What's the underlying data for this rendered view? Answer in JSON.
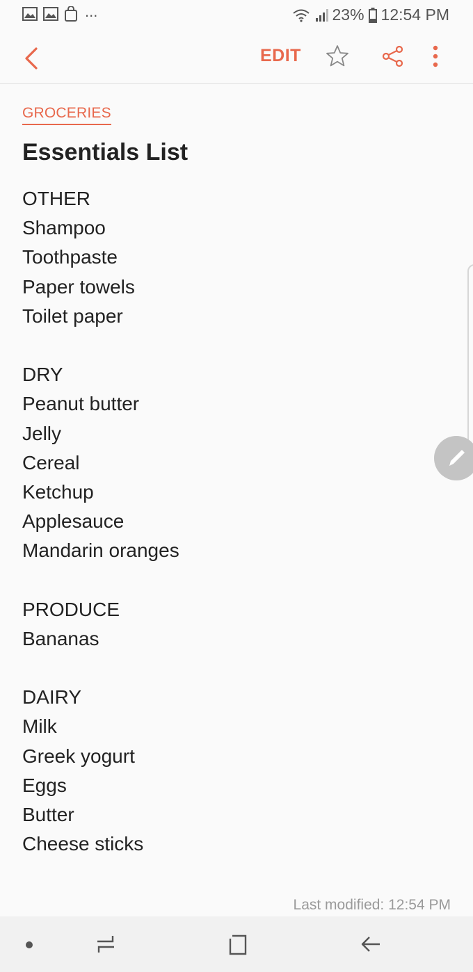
{
  "status_bar": {
    "battery": "23%",
    "time": "12:54 PM",
    "overflow": "..."
  },
  "toolbar": {
    "edit_label": "EDIT"
  },
  "note": {
    "category": "GROCERIES",
    "title": "Essentials List",
    "lines": [
      "OTHER",
      "Shampoo",
      "Toothpaste",
      "Paper towels",
      "Toilet paper",
      "",
      "DRY",
      "Peanut butter",
      "Jelly",
      "Cereal",
      "Ketchup",
      "Applesauce",
      "Mandarin oranges",
      "",
      "PRODUCE",
      "Bananas",
      "",
      "DAIRY",
      "Milk",
      "Greek yogurt",
      "Eggs",
      "Butter",
      "Cheese sticks"
    ],
    "last_modified": "Last modified: 12:54 PM"
  },
  "colors": {
    "accent": "#e8684c",
    "text": "#222222",
    "muted": "#9a9a9a",
    "background": "#fafafa"
  },
  "icons": {
    "status_left": [
      "image-icon",
      "image-icon",
      "shopping-bag-icon"
    ],
    "status_right": [
      "wifi-icon",
      "signal-icon",
      "battery-icon"
    ],
    "toolbar": [
      "back-arrow-icon",
      "star-icon",
      "share-icon",
      "more-vert-icon"
    ],
    "fab": "pen-icon",
    "nav": [
      "nav-dot",
      "recents-icon",
      "home-icon",
      "back-icon"
    ]
  }
}
